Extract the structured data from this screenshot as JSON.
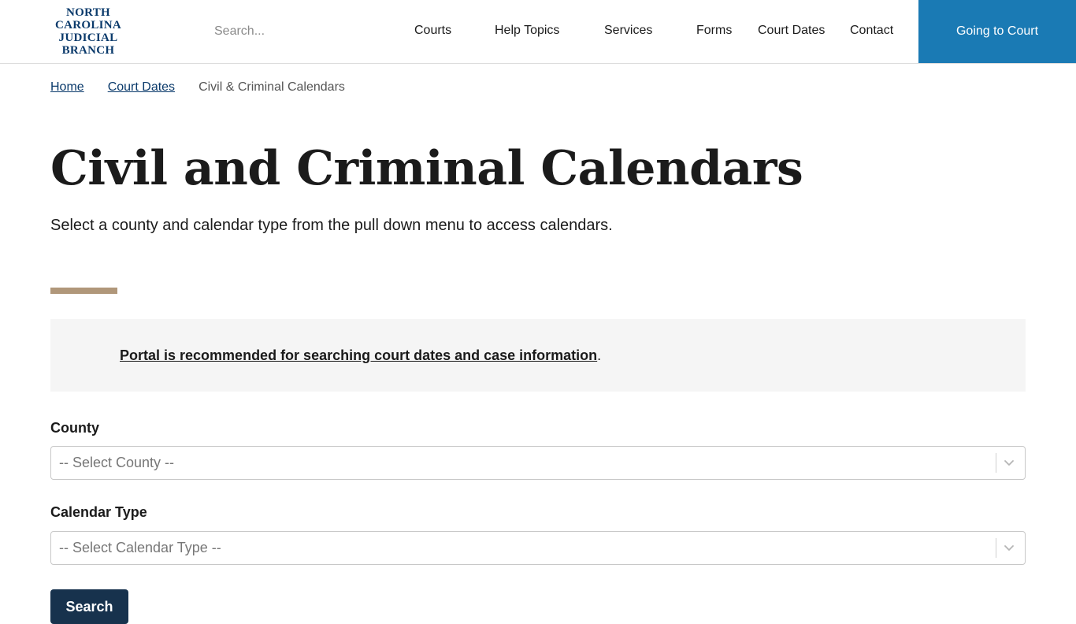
{
  "header": {
    "logo_lines": [
      "NORTH",
      "CAROLINA",
      "JUDICIAL",
      "BRANCH"
    ],
    "search_placeholder": "Search...",
    "nav": [
      "Courts",
      "Help Topics",
      "Services",
      "Forms",
      "Court Dates",
      "Contact"
    ],
    "cta_label": "Going to Court",
    "cta_color": "#1a7ab4"
  },
  "breadcrumb": {
    "items": [
      "Home",
      "Court Dates"
    ],
    "current": "Civil & Criminal Calendars"
  },
  "page": {
    "title": "Civil and Criminal Calendars",
    "intro": "Select a county and calendar type from the pull down menu to access calendars.",
    "accent_color": "#b0977a"
  },
  "notice": {
    "link_text": "Portal is recommended for searching court dates and case information",
    "suffix": "."
  },
  "form": {
    "county_label": "County",
    "county_value": "-- Select County --",
    "calendar_label": "Calendar Type",
    "calendar_value": "-- Select Calendar Type --",
    "submit_label": "Search",
    "submit_color": "#17324d"
  },
  "icons": {
    "dropdown": "chevron-down-icon"
  }
}
